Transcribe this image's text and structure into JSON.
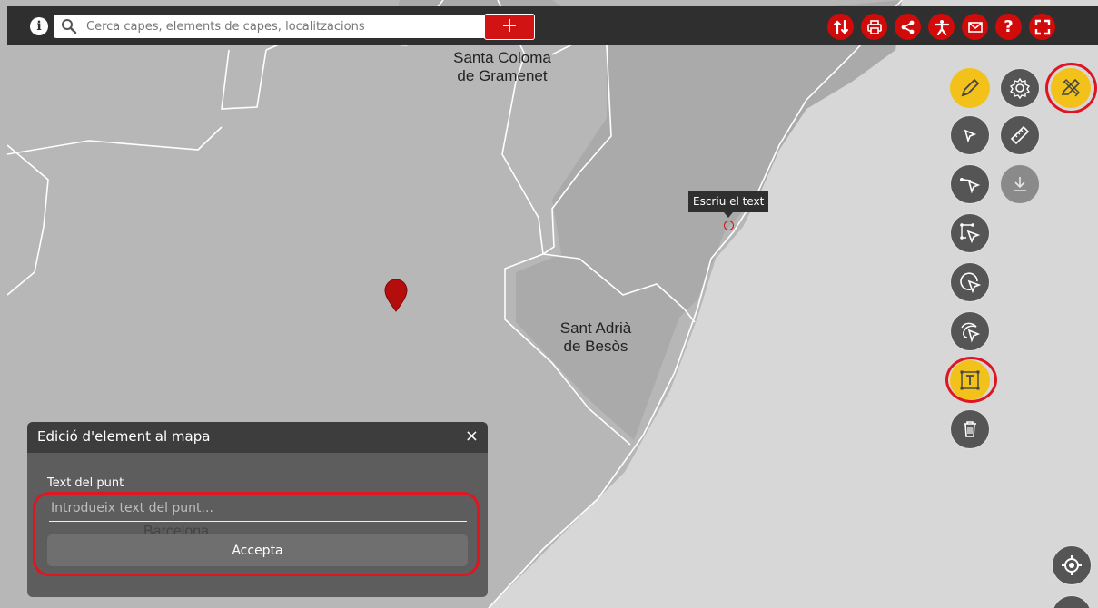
{
  "search": {
    "placeholder": "Cerca capes, elements de capes, localitzacions",
    "add_label": "+"
  },
  "toolbar": {
    "buttons": [
      {
        "name": "swap-icon"
      },
      {
        "name": "print-icon"
      },
      {
        "name": "share-icon"
      },
      {
        "name": "accessibility-icon"
      },
      {
        "name": "mail-icon"
      },
      {
        "name": "help-icon",
        "glyph": "?"
      },
      {
        "name": "fullscreen-icon"
      }
    ]
  },
  "map": {
    "places": [
      {
        "line1": "Santa Coloma",
        "line2": "de Gramenet"
      },
      {
        "line1": "Sant Adrià",
        "line2": "de Besòs"
      }
    ],
    "ghost_label": "Barcelona",
    "tooltip": "Escriu el text"
  },
  "tools": [
    {
      "name": "draw-pencil-icon",
      "state": "active"
    },
    {
      "name": "settings-gear-icon",
      "state": "normal"
    },
    {
      "name": "draw-edit-icon",
      "state": "active"
    },
    {
      "name": "select-point-icon",
      "state": "normal"
    },
    {
      "name": "ruler-icon",
      "state": "normal"
    },
    {
      "name": "select-line-icon",
      "state": "normal"
    },
    {
      "name": "download-icon",
      "state": "disabled"
    },
    {
      "name": "select-polygon-icon",
      "state": "normal"
    },
    {
      "name": "select-circle-icon",
      "state": "normal"
    },
    {
      "name": "select-freehand-icon",
      "state": "normal"
    },
    {
      "name": "text-tool-icon",
      "state": "active"
    },
    {
      "name": "trash-icon",
      "state": "normal"
    }
  ],
  "dialog": {
    "title": "Edició d'element al mapa",
    "close": "×",
    "field_label": "Text del punt",
    "placeholder": "Introdueix text del punt...",
    "value": "",
    "accept_label": "Accepta"
  },
  "colors": {
    "accent_red": "#d10a0a",
    "highlight_red": "#e01522",
    "active_yellow": "#f2c21a",
    "topbar": "#2f2f2f"
  }
}
